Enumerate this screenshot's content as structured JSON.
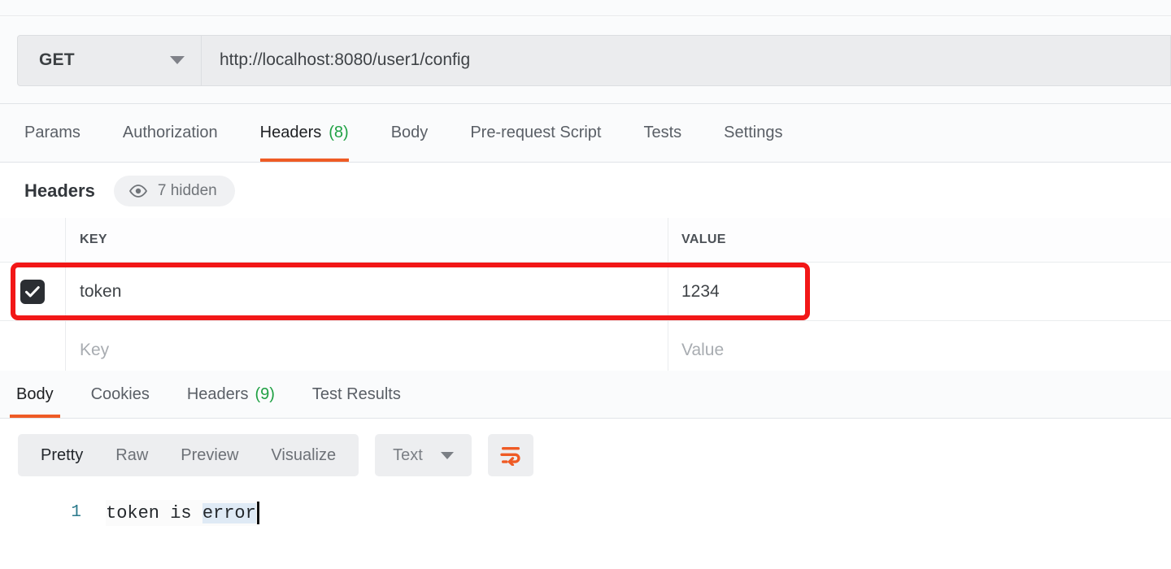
{
  "request": {
    "method": "GET",
    "method_caret_icon": "chevron-down-icon",
    "url": "http://localhost:8080/user1/config",
    "url_placeholder": "Enter URL or paste text"
  },
  "request_tabs": [
    {
      "label": "Params",
      "count": "",
      "active": false
    },
    {
      "label": "Authorization",
      "count": "",
      "active": false
    },
    {
      "label": "Headers",
      "count": "(8)",
      "active": true
    },
    {
      "label": "Body",
      "count": "",
      "active": false
    },
    {
      "label": "Pre-request Script",
      "count": "",
      "active": false
    },
    {
      "label": "Tests",
      "count": "",
      "active": false
    },
    {
      "label": "Settings",
      "count": "",
      "active": false
    }
  ],
  "headers_section": {
    "title": "Headers",
    "hidden_pill": {
      "icon": "eye-icon",
      "label": "7 hidden"
    },
    "columns": {
      "key": "KEY",
      "value": "VALUE"
    },
    "rows": [
      {
        "checked": true,
        "checkbox_icon": "check-icon",
        "key": "token",
        "value": "1234",
        "highlighted": true
      }
    ],
    "placeholder_row": {
      "key": "Key",
      "value": "Value"
    }
  },
  "response_tabs": [
    {
      "label": "Body",
      "count": "",
      "active": true
    },
    {
      "label": "Cookies",
      "count": "",
      "active": false
    },
    {
      "label": "Headers",
      "count": "(9)",
      "active": false
    },
    {
      "label": "Test Results",
      "count": "",
      "active": false
    }
  ],
  "format_toolbar": {
    "views": [
      {
        "label": "Pretty",
        "active": true
      },
      {
        "label": "Raw",
        "active": false
      },
      {
        "label": "Preview",
        "active": false
      },
      {
        "label": "Visualize",
        "active": false
      }
    ],
    "type_select": {
      "value": "Text",
      "caret_icon": "chevron-down-icon"
    },
    "wrap_button_icon": "word-wrap-icon"
  },
  "response_body": {
    "line_number": "1",
    "text_before": "token is ",
    "text_selected": "error"
  },
  "colors": {
    "accent_orange": "#ef5b25",
    "count_green": "#20a144",
    "annotation_red": "#f21717",
    "selection_blue": "#dfeaf5",
    "line_number_teal": "#2c7a8c",
    "checkbox_dark": "#2b2e33"
  }
}
